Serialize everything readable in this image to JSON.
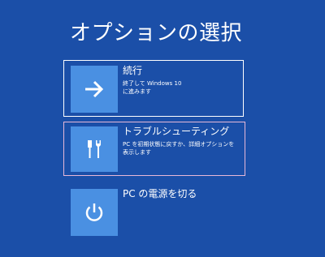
{
  "page": {
    "title": "オプションの選択"
  },
  "options": [
    {
      "label": "続行",
      "desc_lines": [
        "終了して Windows 10",
        "に進みます"
      ],
      "icon": "arrow-right-icon"
    },
    {
      "label": "トラブルシューティング",
      "desc_lines": [
        "PC を初期状態に戻すか、詳細オプションを",
        "表示します"
      ],
      "icon": "tools-icon"
    },
    {
      "label": "PC の電源を切る",
      "desc_lines": [],
      "icon": "power-icon"
    }
  ],
  "colors": {
    "background": "#1b4fa8",
    "tile": "#4a90e2",
    "focus_border": "#ffffff",
    "hover_border": "#e7b8d8"
  }
}
